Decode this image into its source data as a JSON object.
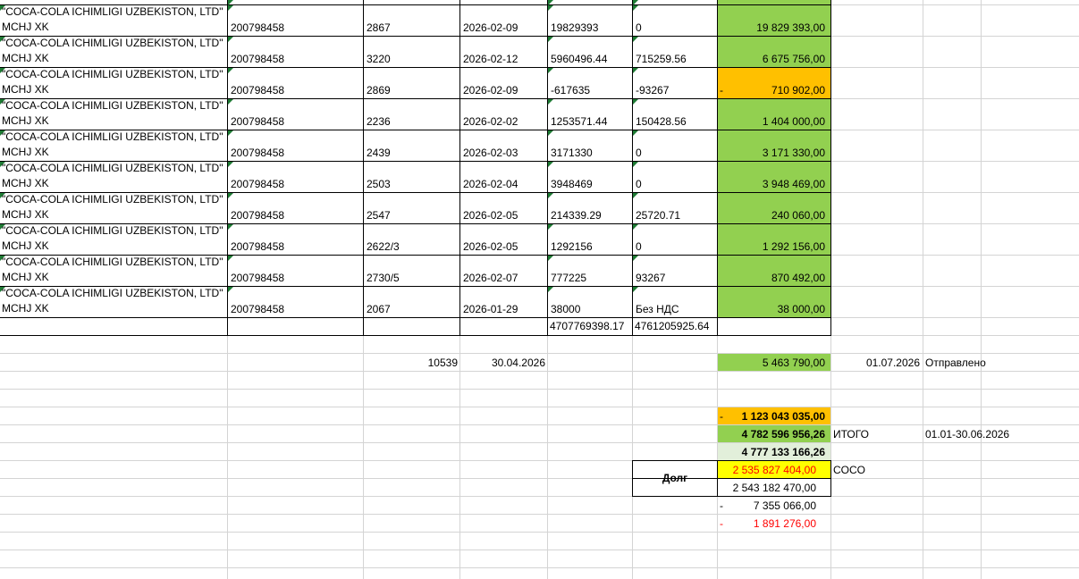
{
  "colors": {
    "green_fill": "#92d050",
    "orange_fill": "#ffc000",
    "yellow_fill": "#ffff00",
    "light_green_fill": "#e2efda",
    "red_text": "#ff0000",
    "gridline": "#d4d4d4",
    "error_indicator": "#1e7b34"
  },
  "table": {
    "rows": [
      {
        "name_line1": "\"COCA-COLA ICHIMLIGI UZBEKISTON, LTD\"",
        "name_line2": "MCHJ XK",
        "inn": "200798458",
        "doc_no": "2867",
        "date": "2026-02-09",
        "amount": "19829393",
        "vat": "0",
        "total": "19 829 393,00",
        "total_prefix": ""
      },
      {
        "name_line1": "\"COCA-COLA ICHIMLIGI UZBEKISTON, LTD\"",
        "name_line2": "MCHJ XK",
        "inn": "200798458",
        "doc_no": "3220",
        "date": "2026-02-12",
        "amount": "5960496.44",
        "vat": "715259.56",
        "total": "6 675 756,00",
        "total_prefix": ""
      },
      {
        "name_line1": "\"COCA-COLA ICHIMLIGI UZBEKISTON, LTD\"",
        "name_line2": "MCHJ XK",
        "inn": "200798458",
        "doc_no": "2869",
        "date": "2026-02-09",
        "amount": "-617635",
        "vat": "-93267",
        "total": "710 902,00",
        "total_prefix": "-"
      },
      {
        "name_line1": "\"COCA-COLA ICHIMLIGI UZBEKISTON, LTD\"",
        "name_line2": "MCHJ XK",
        "inn": "200798458",
        "doc_no": "2236",
        "date": "2026-02-02",
        "amount": "1253571.44",
        "vat": "150428.56",
        "total": "1 404 000,00",
        "total_prefix": ""
      },
      {
        "name_line1": "\"COCA-COLA ICHIMLIGI UZBEKISTON, LTD\"",
        "name_line2": "MCHJ XK",
        "inn": "200798458",
        "doc_no": "2439",
        "date": "2026-02-03",
        "amount": "3171330",
        "vat": "0",
        "total": "3 171 330,00",
        "total_prefix": ""
      },
      {
        "name_line1": "\"COCA-COLA ICHIMLIGI UZBEKISTON, LTD\"",
        "name_line2": "MCHJ XK",
        "inn": "200798458",
        "doc_no": "2503",
        "date": "2026-02-04",
        "amount": "3948469",
        "vat": "0",
        "total": "3 948 469,00",
        "total_prefix": ""
      },
      {
        "name_line1": "\"COCA-COLA ICHIMLIGI UZBEKISTON, LTD\"",
        "name_line2": "MCHJ XK",
        "inn": "200798458",
        "doc_no": "2547",
        "date": "2026-02-05",
        "amount": "214339.29",
        "vat": "25720.71",
        "total": "240 060,00",
        "total_prefix": ""
      },
      {
        "name_line1": "\"COCA-COLA ICHIMLIGI UZBEKISTON, LTD\"",
        "name_line2": "MCHJ XK",
        "inn": "200798458",
        "doc_no": "2622/3",
        "date": "2026-02-05",
        "amount": "1292156",
        "vat": "0",
        "total": "1 292 156,00",
        "total_prefix": ""
      },
      {
        "name_line1": "\"COCA-COLA ICHIMLIGI UZBEKISTON, LTD\"",
        "name_line2": "MCHJ XK",
        "inn": "200798458",
        "doc_no": "2730/5",
        "date": "2026-02-07",
        "amount": "777225",
        "vat": "93267",
        "total": "870 492,00",
        "total_prefix": ""
      },
      {
        "name_line1": "\"COCA-COLA ICHIMLIGI UZBEKISTON, LTD\"",
        "name_line2": "MCHJ XK",
        "inn": "200798458",
        "doc_no": "2067",
        "date": "2026-01-29",
        "amount": "38000",
        "vat": "Без НДС",
        "total": "38 000,00",
        "total_prefix": ""
      }
    ],
    "sum_amount": "4707769398.17",
    "sum_vat": "4761205925.64"
  },
  "invoice_line": {
    "number": "10539",
    "date": "30.04.2026",
    "total": "5 463 790,00",
    "sent_date": "01.07.2026",
    "status": "Отправлено"
  },
  "summary": {
    "orange_prefix": "-",
    "orange_value": "1 123 043 035,00",
    "itogo_value": "4 782 596 956,26",
    "itogo_label": "ИТОГО",
    "period": "01.01-30.06.2026",
    "subtotal": "4 777 133 166,26",
    "debt_label": "Долг",
    "debt_yellow": "2 535 827 404,00",
    "coco_label": "COCO",
    "debt_value": "2 543 182 470,00",
    "diff1_prefix": "-",
    "diff1": "7 355 066,00",
    "diff2_prefix": "-",
    "diff2": "1 891 276,00"
  }
}
